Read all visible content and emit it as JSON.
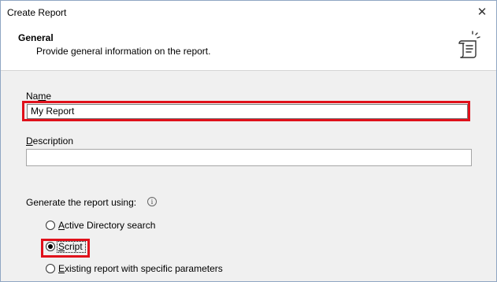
{
  "window": {
    "title": "Create Report"
  },
  "header": {
    "title": "General",
    "subtitle": "Provide general information on the report.",
    "icon": "report-scroll-icon"
  },
  "form": {
    "name": {
      "label_first": "Na",
      "label_underline": "m",
      "label_rest": "e",
      "value": "My Report"
    },
    "description": {
      "label_underline": "D",
      "label_rest": "escription",
      "value": ""
    },
    "generate": {
      "label": "Generate the report using:",
      "info_icon": "i",
      "options": [
        {
          "underline": "A",
          "rest": "ctive Directory search",
          "selected": false
        },
        {
          "underline": "S",
          "rest": "cript",
          "selected": true
        },
        {
          "underline": "E",
          "rest": "xisting report with specific parameters",
          "selected": false
        }
      ]
    }
  },
  "colors": {
    "highlight": "#e0101a",
    "border": "#8fa6c3"
  }
}
